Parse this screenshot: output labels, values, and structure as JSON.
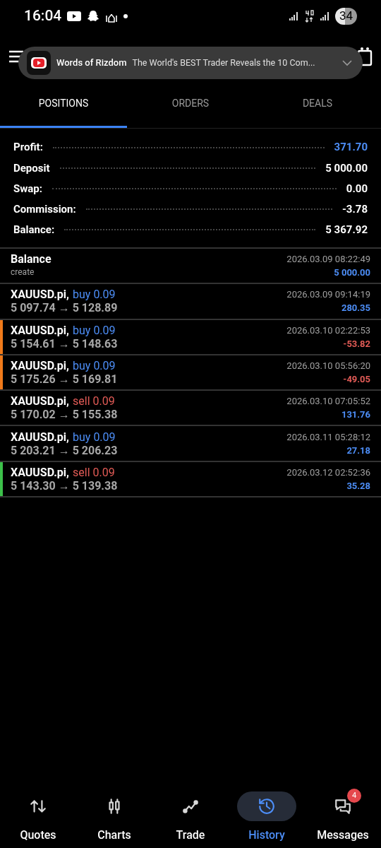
{
  "status_bar": {
    "time": "16:04",
    "battery": "34"
  },
  "notification": {
    "channel": "Words of Rizdom",
    "title": "The World's BEST Trader Reveals the 10 Com..."
  },
  "tabs": [
    {
      "label": "POSITIONS",
      "selected": true
    },
    {
      "label": "ORDERS",
      "selected": false
    },
    {
      "label": "DEALS",
      "selected": false
    }
  ],
  "summary": [
    {
      "label": "Profit:",
      "value": "371.70",
      "highlight": true
    },
    {
      "label": "Deposit",
      "value": "5 000.00",
      "highlight": false
    },
    {
      "label": "Swap:",
      "value": "0.00",
      "highlight": false
    },
    {
      "label": "Commission:",
      "value": "-3.78",
      "highlight": false
    },
    {
      "label": "Balance:",
      "value": "5 367.92",
      "highlight": false
    }
  ],
  "deals": [
    {
      "kind": "balance",
      "title": "Balance",
      "subtitle": "create",
      "time": "2026.03.09 08:22:49",
      "amount": "5 000.00",
      "loss": false
    },
    {
      "kind": "buy",
      "symbol": "XAUUSD.pi,",
      "side": "buy 0.09",
      "prices": "5 097.74 → 5 128.89",
      "time": "2026.03.09 09:14:19",
      "amount": "280.35",
      "loss": false
    },
    {
      "kind": "buy",
      "symbol": "XAUUSD.pi,",
      "side": "buy 0.09",
      "prices": "5 154.61 → 5 148.63",
      "time": "2026.03.10 02:22:53",
      "amount": "-53.82",
      "loss": true,
      "color": "#f07a1a"
    },
    {
      "kind": "buy",
      "symbol": "XAUUSD.pi,",
      "side": "buy 0.09",
      "prices": "5 175.26 → 5 169.81",
      "time": "2026.03.10 05:56:20",
      "amount": "-49.05",
      "loss": true,
      "color": "#f07a1a"
    },
    {
      "kind": "sell",
      "symbol": "XAUUSD.pi,",
      "side": "sell 0.09",
      "prices": "5 170.02 → 5 155.38",
      "time": "2026.03.10 07:05:52",
      "amount": "131.76",
      "loss": false
    },
    {
      "kind": "buy",
      "symbol": "XAUUSD.pi,",
      "side": "buy 0.09",
      "prices": "5 203.21 → 5 206.23",
      "time": "2026.03.11 05:28:12",
      "amount": "27.18",
      "loss": false
    },
    {
      "kind": "sell",
      "symbol": "XAUUSD.pi,",
      "side": "sell 0.09",
      "prices": "5 143.30 → 5 139.38",
      "time": "2026.03.12 02:52:36",
      "amount": "35.28",
      "loss": false,
      "color": "#3cc04a"
    }
  ],
  "nav": [
    {
      "label": "Quotes",
      "kind": "quotes",
      "selected": false
    },
    {
      "label": "Charts",
      "kind": "charts",
      "selected": false
    },
    {
      "label": "Trade",
      "kind": "trade",
      "selected": false
    },
    {
      "label": "History",
      "kind": "history",
      "selected": true
    },
    {
      "label": "Messages",
      "kind": "messages",
      "selected": false,
      "badge": "4"
    }
  ]
}
